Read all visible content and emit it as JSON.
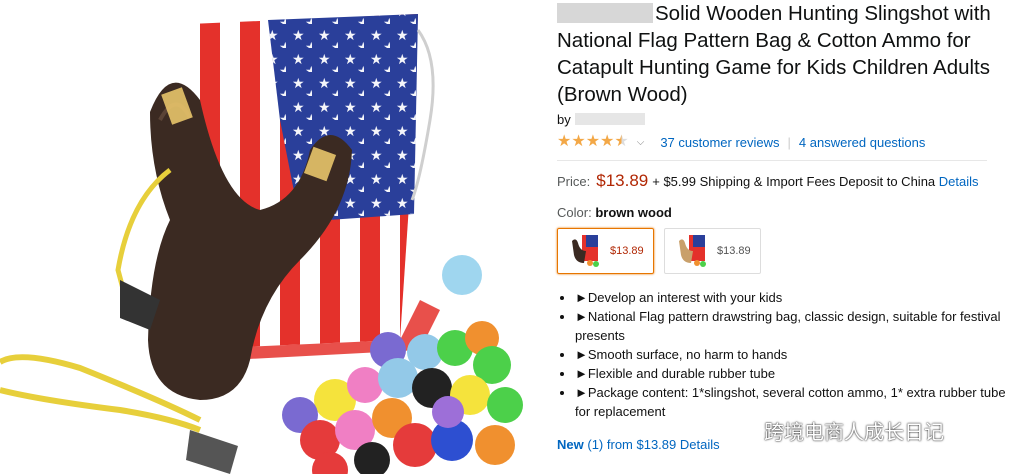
{
  "product": {
    "title": "Solid Wooden Hunting Slingshot with National Flag Pattern Bag & Cotton Ammo for Catapult Hunting Game for Kids Children Adults (Brown Wood)",
    "by_label": "by",
    "rating_stars": 4.5,
    "reviews_link": "37 customer reviews",
    "separator": "|",
    "questions_link": "4 answered questions"
  },
  "pricing": {
    "label": "Price:",
    "price": "$13.89",
    "shipping": "+ $5.99 Shipping & Import Fees Deposit to China",
    "details_link": "Details"
  },
  "color": {
    "label": "Color:",
    "value": "brown wood",
    "swatches": [
      {
        "price": "$13.89",
        "selected": true
      },
      {
        "price": "$13.89",
        "selected": false
      }
    ]
  },
  "bullets": [
    "►Develop an interest with your kids",
    "►National Flag pattern drawstring bag, classic design, suitable for festival presents",
    "►Smooth surface, no harm to hands",
    "►Flexible and durable rubber tube",
    "►Package content: 1*slingshot, several cotton ammo, 1* extra rubber tube for replacement"
  ],
  "offers": {
    "new_label": "New",
    "count": "(1)",
    "from_text": "from $13.89",
    "details_link": "Details"
  },
  "watermark": {
    "text": "跨境电商人成长日记",
    "icon": "wechat-icon"
  },
  "colors": {
    "link": "#0066c0",
    "price": "#b12704",
    "star": "#f3a847",
    "selected_border": "#e77600"
  }
}
